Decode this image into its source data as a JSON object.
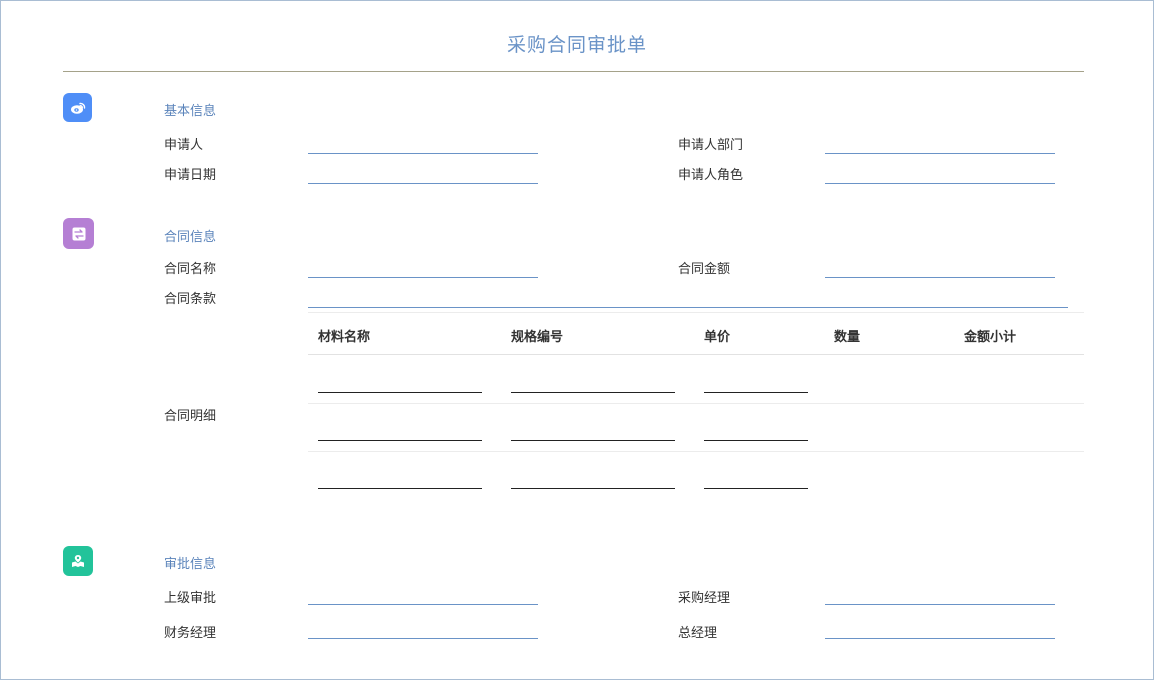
{
  "form": {
    "title": "采购合同审批单"
  },
  "colors": {
    "title": "#6a93c7",
    "section_title": "#5b84bb",
    "field_line": "#6a93c7",
    "icon_basic": "#4f8ef7",
    "icon_contract": "#b57fd4",
    "icon_approval": "#22c39a"
  },
  "sections": {
    "basic": {
      "title": "基本信息",
      "icon": "weibo-icon",
      "fields": {
        "applicant": "申请人",
        "applicant_dept": "申请人部门",
        "apply_date": "申请日期",
        "applicant_role": "申请人角色"
      }
    },
    "contract": {
      "title": "合同信息",
      "icon": "swap-icon",
      "fields": {
        "contract_name": "合同名称",
        "contract_amount": "合同金额",
        "contract_terms": "合同条款",
        "contract_detail": "合同明细"
      },
      "detail_table": {
        "columns": [
          "材料名称",
          "规格编号",
          "单价",
          "数量",
          "金额小计"
        ],
        "row_count": 3
      }
    },
    "approval": {
      "title": "审批信息",
      "icon": "map-icon",
      "fields": {
        "superior": "上级审批",
        "purchase_manager": "采购经理",
        "finance_manager": "财务经理",
        "general_manager": "总经理"
      }
    }
  }
}
